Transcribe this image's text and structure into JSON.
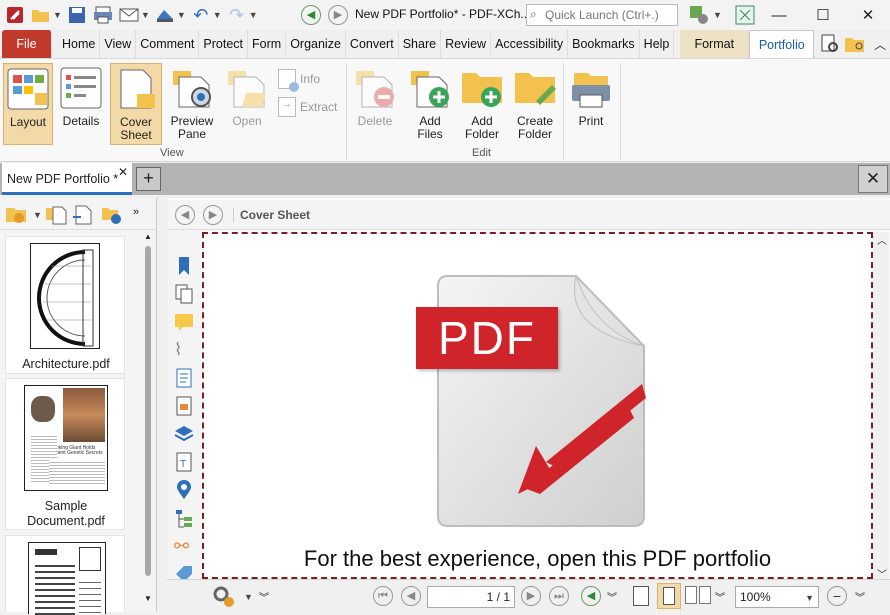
{
  "titlebar": {
    "title": "New PDF Portfolio* - PDF-XCh...",
    "search_placeholder": "Quick Launch (Ctrl+.)"
  },
  "menu_tabs": [
    "File",
    "Home",
    "View",
    "Comment",
    "Protect",
    "Form",
    "Organize",
    "Convert",
    "Share",
    "Review",
    "Accessibility",
    "Bookmarks",
    "Help",
    "Format",
    "Portfolio"
  ],
  "ribbon": {
    "layout": "Layout",
    "details": "Details",
    "cover_sheet": "Cover Sheet",
    "preview_pane": "Preview Pane",
    "open": "Open",
    "info": "Info",
    "extract": "Extract",
    "delete": "Delete",
    "add_files": "Add Files",
    "add_folder": "Add Folder",
    "create_folder": "Create Folder",
    "print": "Print",
    "group_view": "View",
    "group_edit": "Edit"
  },
  "document_tab": {
    "label": "New PDF Portfolio *"
  },
  "files": [
    {
      "name": "Architecture.pdf"
    },
    {
      "name": "Sample Document.pdf"
    }
  ],
  "thumbnail_text": {
    "sample_heading": "Thinking Giant Holds Ancient Genetic Secrets"
  },
  "viewer": {
    "breadcrumb": "Cover Sheet",
    "cover_message": "For the best experience, open this PDF portfolio",
    "pdf_logo_text": "PDF"
  },
  "status": {
    "page": "1 / 1",
    "zoom": "100%"
  },
  "colors": {
    "file_tab": "#c0392b",
    "selected_ribbon": "#f3d9a7",
    "pdf_red": "#d0242b",
    "accent_blue": "#2d6fb9"
  }
}
